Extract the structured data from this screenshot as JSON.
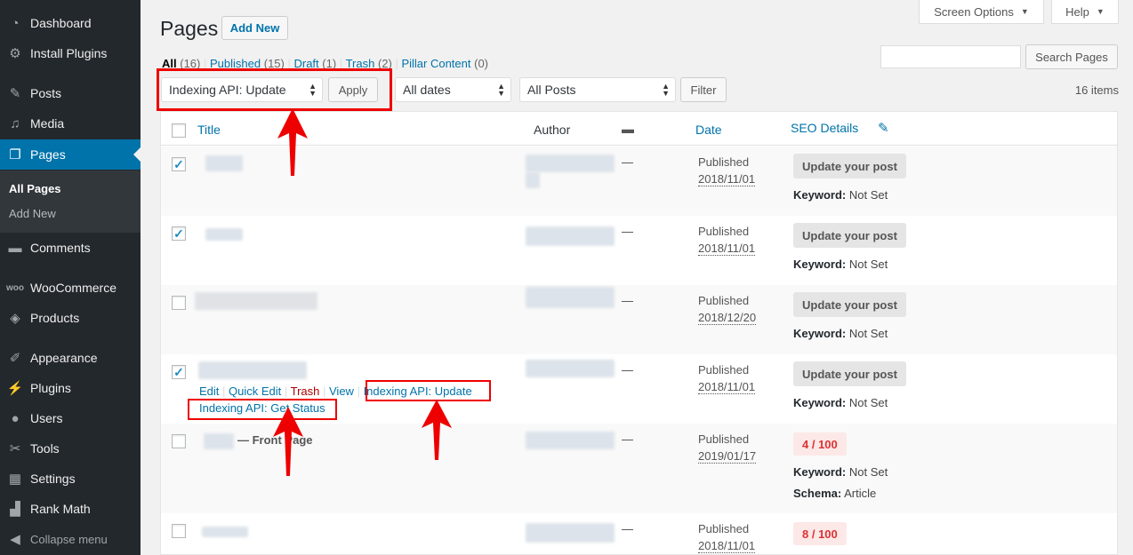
{
  "sidebar": {
    "items": [
      {
        "label": "Dashboard",
        "icon": "dashboard-icon"
      },
      {
        "label": "Install Plugins",
        "icon": "gear-icon"
      },
      {
        "label": "Posts",
        "icon": "pin-icon"
      },
      {
        "label": "Media",
        "icon": "media-icon"
      },
      {
        "label": "Pages",
        "icon": "pages-icon"
      },
      {
        "label": "Comments",
        "icon": "comment-icon"
      },
      {
        "label": "WooCommerce",
        "icon": "woo-icon"
      },
      {
        "label": "Products",
        "icon": "box-icon"
      },
      {
        "label": "Appearance",
        "icon": "brush-icon"
      },
      {
        "label": "Plugins",
        "icon": "plug-icon"
      },
      {
        "label": "Users",
        "icon": "user-icon"
      },
      {
        "label": "Tools",
        "icon": "wrench-icon"
      },
      {
        "label": "Settings",
        "icon": "settings-icon"
      },
      {
        "label": "Rank Math",
        "icon": "chart-icon"
      }
    ],
    "submenu": {
      "all_pages": "All Pages",
      "add_new": "Add New"
    },
    "collapse": "Collapse menu",
    "accent": "#0073aa"
  },
  "header": {
    "title": "Pages",
    "add_new": "Add New",
    "screen_options": "Screen Options",
    "help": "Help",
    "search_button": "Search Pages",
    "search_value": ""
  },
  "filters": {
    "views": [
      {
        "label": "All",
        "count": "(16)"
      },
      {
        "label": "Published",
        "count": "(15)"
      },
      {
        "label": "Draft",
        "count": "(1)"
      },
      {
        "label": "Trash",
        "count": "(2)"
      },
      {
        "label": "Pillar Content",
        "count": "(0)"
      }
    ],
    "bulk_action": "Indexing API: Update",
    "apply": "Apply",
    "dates": "All dates",
    "posts": "All Posts",
    "filter": "Filter",
    "items_count": "16 items"
  },
  "table": {
    "columns": {
      "title": "Title",
      "author": "Author",
      "date": "Date",
      "seo": "SEO Details"
    },
    "rows": [
      {
        "checked": "✓",
        "comments": "—",
        "status": "Published",
        "date": "2018/11/01",
        "seo": "Update your post",
        "kw_label": "Keyword:",
        "kw_value": "Not Set"
      },
      {
        "checked": "✓",
        "comments": "—",
        "status": "Published",
        "date": "2018/11/01",
        "seo": "Update your post",
        "kw_label": "Keyword:",
        "kw_value": "Not Set"
      },
      {
        "checked": "",
        "comments": "—",
        "status": "Published",
        "date": "2018/12/20",
        "seo": "Update your post",
        "kw_label": "Keyword:",
        "kw_value": "Not Set"
      },
      {
        "checked": "✓",
        "comments": "—",
        "status": "Published",
        "date": "2018/11/01",
        "seo": "Update your post",
        "kw_label": "Keyword:",
        "kw_value": "Not Set"
      },
      {
        "checked": "",
        "comments": "—",
        "status": "Published",
        "date": "2019/01/17",
        "seo": "4 / 100",
        "kw_label": "Keyword:",
        "kw_value": "Not Set",
        "schema_label": "Schema:",
        "schema_value": "Article",
        "title_suffix": "— Front Page"
      },
      {
        "checked": "",
        "comments": "—",
        "status": "Published",
        "date": "2018/11/01",
        "seo": "8 / 100"
      }
    ],
    "row_actions": {
      "edit": "Edit",
      "quick_edit": "Quick Edit",
      "trash": "Trash",
      "view": "View",
      "index_update": "Indexing API: Update",
      "index_status": "Indexing API: Get Status"
    }
  }
}
